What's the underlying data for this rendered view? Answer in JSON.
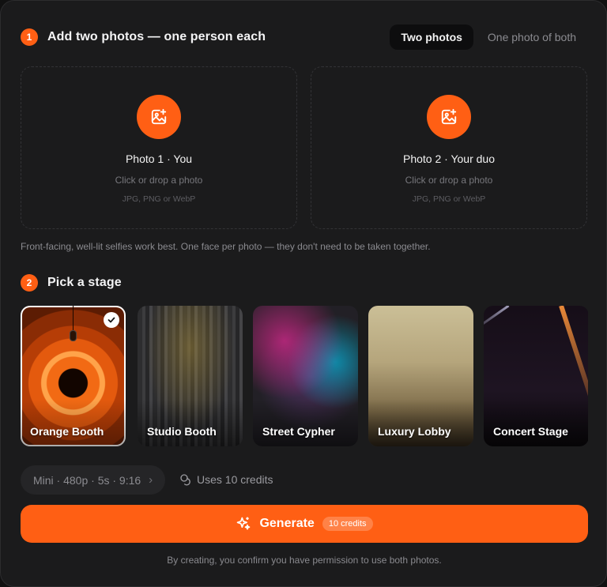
{
  "steps": [
    {
      "number": "1",
      "title": "Add two photos — one person each"
    },
    {
      "number": "2",
      "title": "Pick a stage"
    }
  ],
  "mode_toggle": {
    "options": [
      "Two photos",
      "One photo of both"
    ],
    "selected": "Two photos"
  },
  "dropzones": [
    {
      "title": "Photo 1 · You",
      "subtitle": "Click or drop a photo",
      "formats": "JPG, PNG or WebP",
      "icon": "image-add-icon"
    },
    {
      "title": "Photo 2 · Your duo",
      "subtitle": "Click or drop a photo",
      "formats": "JPG, PNG or WebP",
      "icon": "image-add-icon"
    }
  ],
  "hint": "Front-facing, well-lit selfies work best. One face per photo — they don't need to be taken together.",
  "stages": [
    {
      "label": "Orange Booth",
      "selected": true
    },
    {
      "label": "Studio Booth",
      "selected": false
    },
    {
      "label": "Street Cypher",
      "selected": false
    },
    {
      "label": "Luxury Lobby",
      "selected": false
    },
    {
      "label": "Concert Stage",
      "selected": false
    }
  ],
  "settings_pill": {
    "label": "Mini · 480p · 5s · 9:16",
    "chevron": "›"
  },
  "credits_note": "Uses 10 credits",
  "generate": {
    "label": "Generate",
    "badge": "10 credits"
  },
  "footer": "By creating, you confirm you have permission to use both photos.",
  "colors": {
    "accent": "#ff5f14",
    "panel": "#1b1b1c",
    "text_muted": "#8a8a8f"
  }
}
